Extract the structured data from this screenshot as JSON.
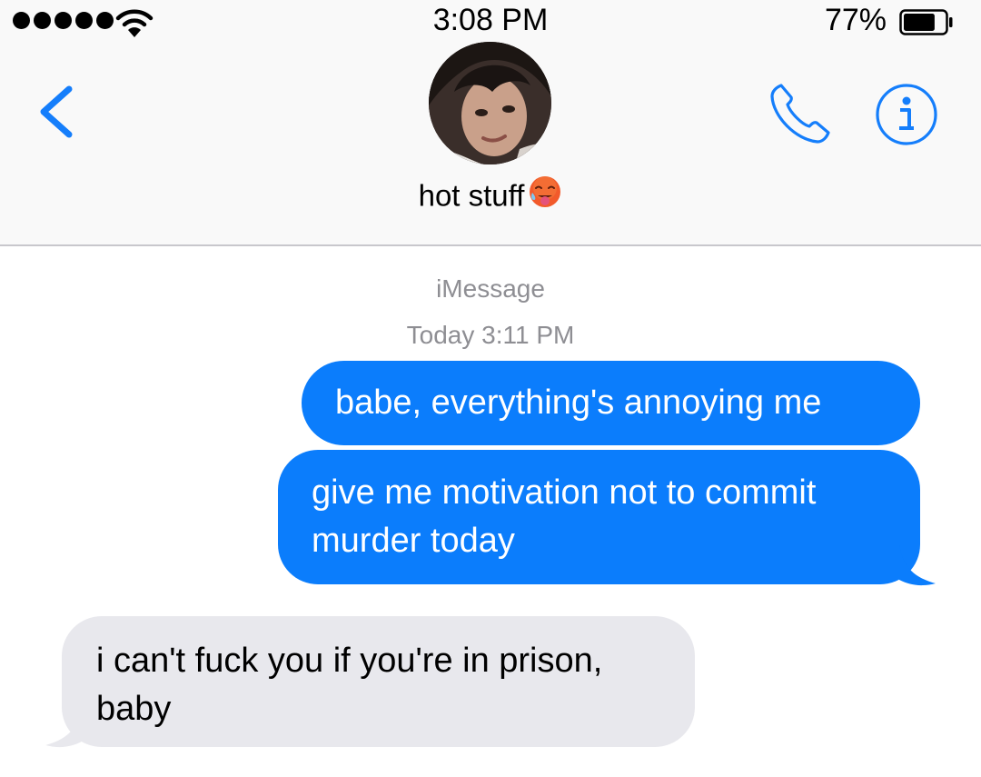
{
  "status_bar": {
    "time": "3:08 PM",
    "battery_percent": "77%",
    "battery_level": 0.77,
    "signal_bars": 5,
    "icons": [
      "signal-dots-icon",
      "wifi-icon",
      "battery-icon"
    ]
  },
  "header": {
    "contact_name": "hot stuff",
    "contact_emoji_icon": "hot-face-emoji-icon",
    "icons": [
      "back-chevron-icon",
      "phone-icon",
      "info-icon"
    ],
    "accent_color": "#157efb"
  },
  "conversation": {
    "service": "iMessage",
    "timestamp": "Today 3:11 PM",
    "messages": [
      {
        "direction": "outgoing",
        "lines": [
          "babe, everything's annoying me"
        ]
      },
      {
        "direction": "outgoing",
        "lines": [
          "give me motivation not to commit",
          "murder today"
        ]
      },
      {
        "direction": "incoming",
        "lines": [
          "i can't fuck you if you're in prison,",
          "baby"
        ]
      }
    ],
    "outgoing_color": "#0b7dfc",
    "incoming_color": "#e8e8ed"
  }
}
